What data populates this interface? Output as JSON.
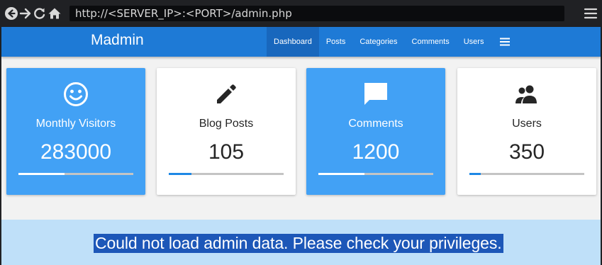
{
  "browser": {
    "url": "http://<SERVER_IP>:<PORT>/admin.php",
    "icons": [
      "back-icon",
      "forward-icon",
      "reload-icon",
      "home-icon",
      "menu-icon"
    ]
  },
  "app": {
    "brand": "Madmin",
    "nav": [
      {
        "label": "Dashboard",
        "active": true
      },
      {
        "label": "Posts",
        "active": false
      },
      {
        "label": "Categories",
        "active": false
      },
      {
        "label": "Comments",
        "active": false
      },
      {
        "label": "Users",
        "active": false
      }
    ]
  },
  "cards": [
    {
      "title": "Monthly Visitors",
      "value": "283000",
      "icon": "smiley-icon",
      "style": "blue",
      "progress": 0.4
    },
    {
      "title": "Blog Posts",
      "value": "105",
      "icon": "pencil-icon",
      "style": "white",
      "progress": 0.2
    },
    {
      "title": "Comments",
      "value": "1200",
      "icon": "comment-icon",
      "style": "blue",
      "progress": 0.4
    },
    {
      "title": "Users",
      "value": "350",
      "icon": "users-icon",
      "style": "white",
      "progress": 0.1
    }
  ],
  "alert": {
    "message": "Could not load admin data. Please check your privileges."
  },
  "colors": {
    "chrome": "#202124",
    "appbar": "#1e7ad6",
    "card_blue": "#42a1f5",
    "alert_bg": "#bfe0f9",
    "selection": "#1d57b8"
  }
}
